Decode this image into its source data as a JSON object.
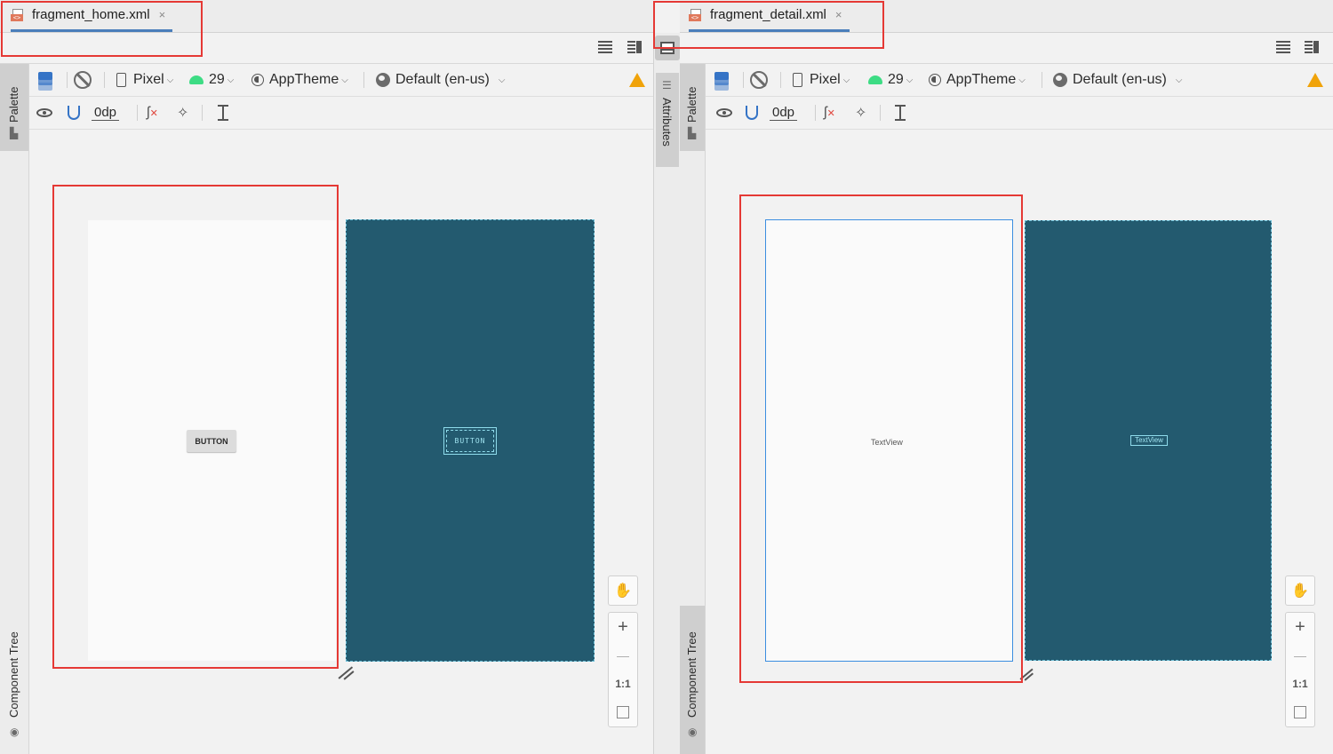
{
  "left": {
    "tab": {
      "label": "fragment_home.xml",
      "close": "×"
    },
    "strip": {
      "palette": "Palette",
      "component_tree": "Component Tree"
    },
    "toolbar1": {
      "device": "Pixel",
      "api": "29",
      "theme": "AppTheme",
      "locale": "Default (en-us)"
    },
    "toolbar2": {
      "margin": "0dp"
    },
    "preview": {
      "widget": "BUTTON"
    },
    "zoom": {
      "zoom_in": "+",
      "zoom_out": "—",
      "actual_size": "1:1"
    }
  },
  "right": {
    "tab": {
      "label": "fragment_detail.xml",
      "close": "×"
    },
    "strip": {
      "palette": "Palette",
      "component_tree": "Component Tree"
    },
    "toolbar1": {
      "device": "Pixel",
      "api": "29",
      "theme": "AppTheme",
      "locale": "Default (en-us)"
    },
    "toolbar2": {
      "margin": "0dp"
    },
    "preview": {
      "widget": "TextView"
    },
    "zoom": {
      "zoom_in": "+",
      "zoom_out": "—",
      "actual_size": "1:1"
    }
  },
  "attributes_panel": {
    "label": "Attributes"
  },
  "icons": {
    "design_surface": "layers-icon",
    "orientation": "rotate-icon",
    "device": "phone-icon",
    "api": "android-icon",
    "theme": "theme-icon",
    "locale": "globe-icon",
    "warning": "warning-icon",
    "view_options": "eye-icon",
    "autoconnect": "magnet-icon",
    "clear_constraints": "constraint-icon",
    "infer_constraints": "magic-wand-icon",
    "guidelines": "guideline-icon",
    "pan": "hand-icon",
    "fit": "fit-screen-icon"
  },
  "colors": {
    "accent": "#3574c6",
    "blueprint_bg": "#235a6f",
    "annotation": "#e53935",
    "warning": "#f0a30a",
    "android": "#3ddc84"
  }
}
